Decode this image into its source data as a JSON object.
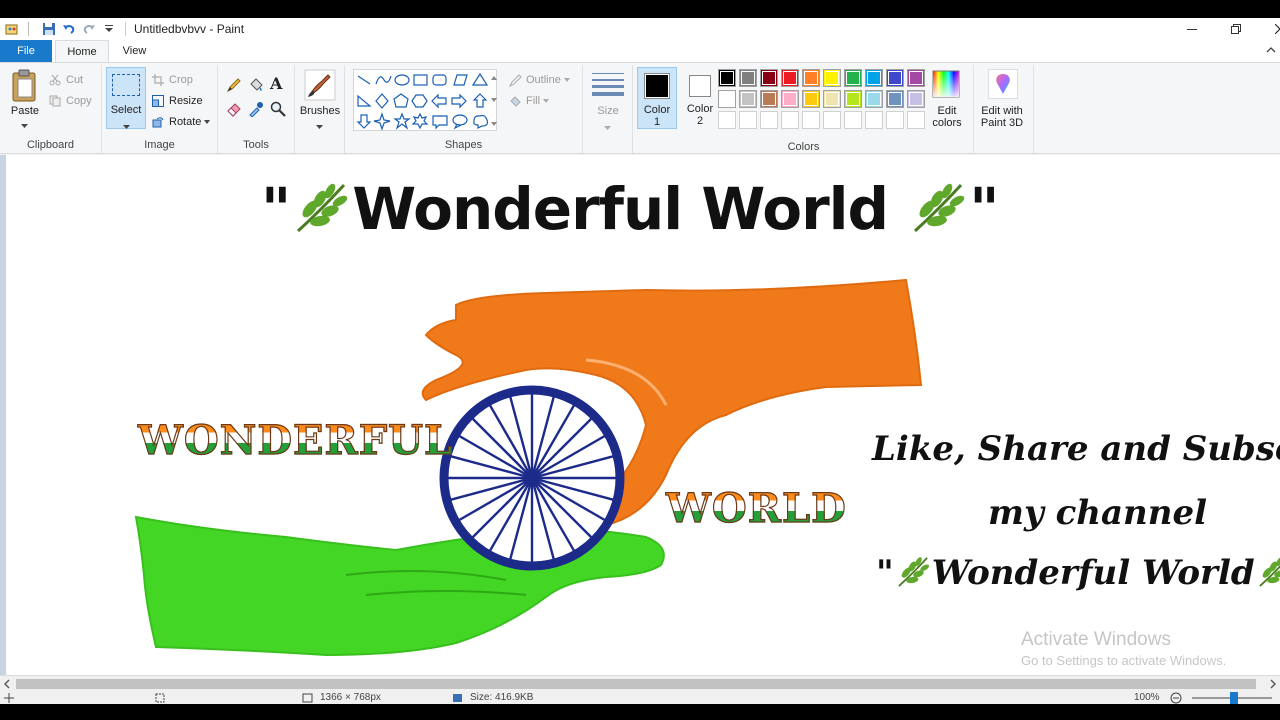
{
  "window": {
    "title": "Untitledbvbvv - Paint"
  },
  "tabs": {
    "file": "File",
    "home": "Home",
    "view": "View"
  },
  "clipboard": {
    "paste": "Paste",
    "cut": "Cut",
    "copy": "Copy",
    "label": "Clipboard"
  },
  "image": {
    "select": "Select",
    "crop": "Crop",
    "resize": "Resize",
    "rotate": "Rotate",
    "label": "Image"
  },
  "tools": {
    "label": "Tools"
  },
  "brushes": {
    "label": "Brushes"
  },
  "shapes": {
    "outline": "Outline",
    "fill": "Fill",
    "label": "Shapes"
  },
  "size": {
    "label": "Size"
  },
  "colors": {
    "color1": "Color",
    "color1_num": "1",
    "color2": "Color",
    "color2_num": "2",
    "edit": "Edit",
    "edit2": "colors",
    "paint3d": "Edit with",
    "paint3d2": "Paint 3D",
    "label": "Colors",
    "active_color1": "#000000",
    "active_color2": "#ffffff",
    "palette_row1": [
      "#000000",
      "#7f7f7f",
      "#880015",
      "#ed1c24",
      "#ff7f27",
      "#fff200",
      "#22b14c",
      "#00a2e8",
      "#3f48cc",
      "#a349a4"
    ],
    "palette_row2": [
      "#ffffff",
      "#c3c3c3",
      "#b97a57",
      "#ffaec9",
      "#ffc90e",
      "#efe4b0",
      "#b5e61d",
      "#99d9ea",
      "#7092be",
      "#c8bfe7"
    ]
  },
  "canvas_text": {
    "headline_open": "\"",
    "headline": "Wonderful World",
    "headline_close": "\"",
    "wonderful_caps": "WONDERFUL",
    "world_caps": "WORLD",
    "line1": "Like,  Share and Subscribe",
    "line2": "my channel",
    "line3_open": "\"",
    "line3": "Wonderful World",
    "line3_close": "\"",
    "watermark1": "Activate Windows",
    "watermark2": "Go to Settings to activate Windows."
  },
  "status": {
    "dimensions": "1366 × 768px",
    "size": "Size: 416.9KB",
    "zoom": "100%"
  }
}
